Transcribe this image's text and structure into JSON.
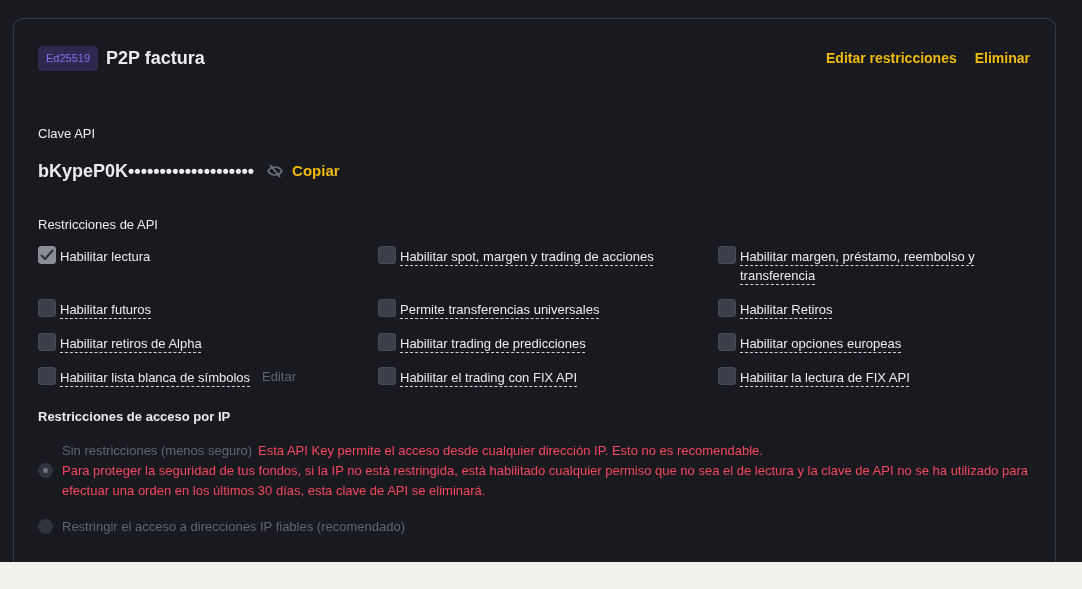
{
  "header": {
    "badge": "Ed25519",
    "title": "P2P factura",
    "actions": [
      "Editar restricciones",
      "Eliminar"
    ]
  },
  "api_key": {
    "label": "Clave API",
    "value": "bKypeP0K••••••••••••••••••••",
    "copy": "Copiar"
  },
  "restrictions": {
    "title": "Restricciones de API",
    "items": [
      {
        "label": "Habilitar lectura",
        "checked": true,
        "dashed": false
      },
      {
        "label": "Habilitar spot, margen y trading de acciones",
        "checked": false,
        "dashed": true
      },
      {
        "label": "Habilitar margen, préstamo, reembolso y transferencia",
        "checked": false,
        "dashed": true
      },
      {
        "label": "Habilitar futuros",
        "checked": false,
        "dashed": true
      },
      {
        "label": "Permite transferencias universales",
        "checked": false,
        "dashed": true
      },
      {
        "label": "Habilitar Retiros",
        "checked": false,
        "dashed": true
      },
      {
        "label": "Habilitar retiros de Alpha",
        "checked": false,
        "dashed": true
      },
      {
        "label": "Habilitar trading de predicciones",
        "checked": false,
        "dashed": true
      },
      {
        "label": "Habilitar opciones europeas",
        "checked": false,
        "dashed": true
      },
      {
        "label": "Habilitar lista blanca de símbolos",
        "checked": false,
        "dashed": true,
        "edit": "Editar"
      },
      {
        "label": "Habilitar el trading con FIX API",
        "checked": false,
        "dashed": true
      },
      {
        "label": "Habilitar la lectura de FIX API",
        "checked": false,
        "dashed": true
      }
    ]
  },
  "ip_access": {
    "title": "Restricciones de acceso por IP",
    "options": [
      {
        "label": "Sin restricciones (menos seguro)",
        "selected": true,
        "disabled": true,
        "warning": "Esta API Key permite el acceso desde cualquier dirección IP. Esto no es recomendable.",
        "note": "Para proteger la seguridad de tus fondos, si la IP no está restringida, está habilitado cualquier permiso que no sea el de lectura y la clave de API no se ha utilizado para efectuar una orden en los últimos 30 días, esta clave de API se eliminará."
      },
      {
        "label": "Restringir el acceso a direcciones IP fiables (recomendado)",
        "selected": false,
        "disabled": true
      }
    ]
  }
}
